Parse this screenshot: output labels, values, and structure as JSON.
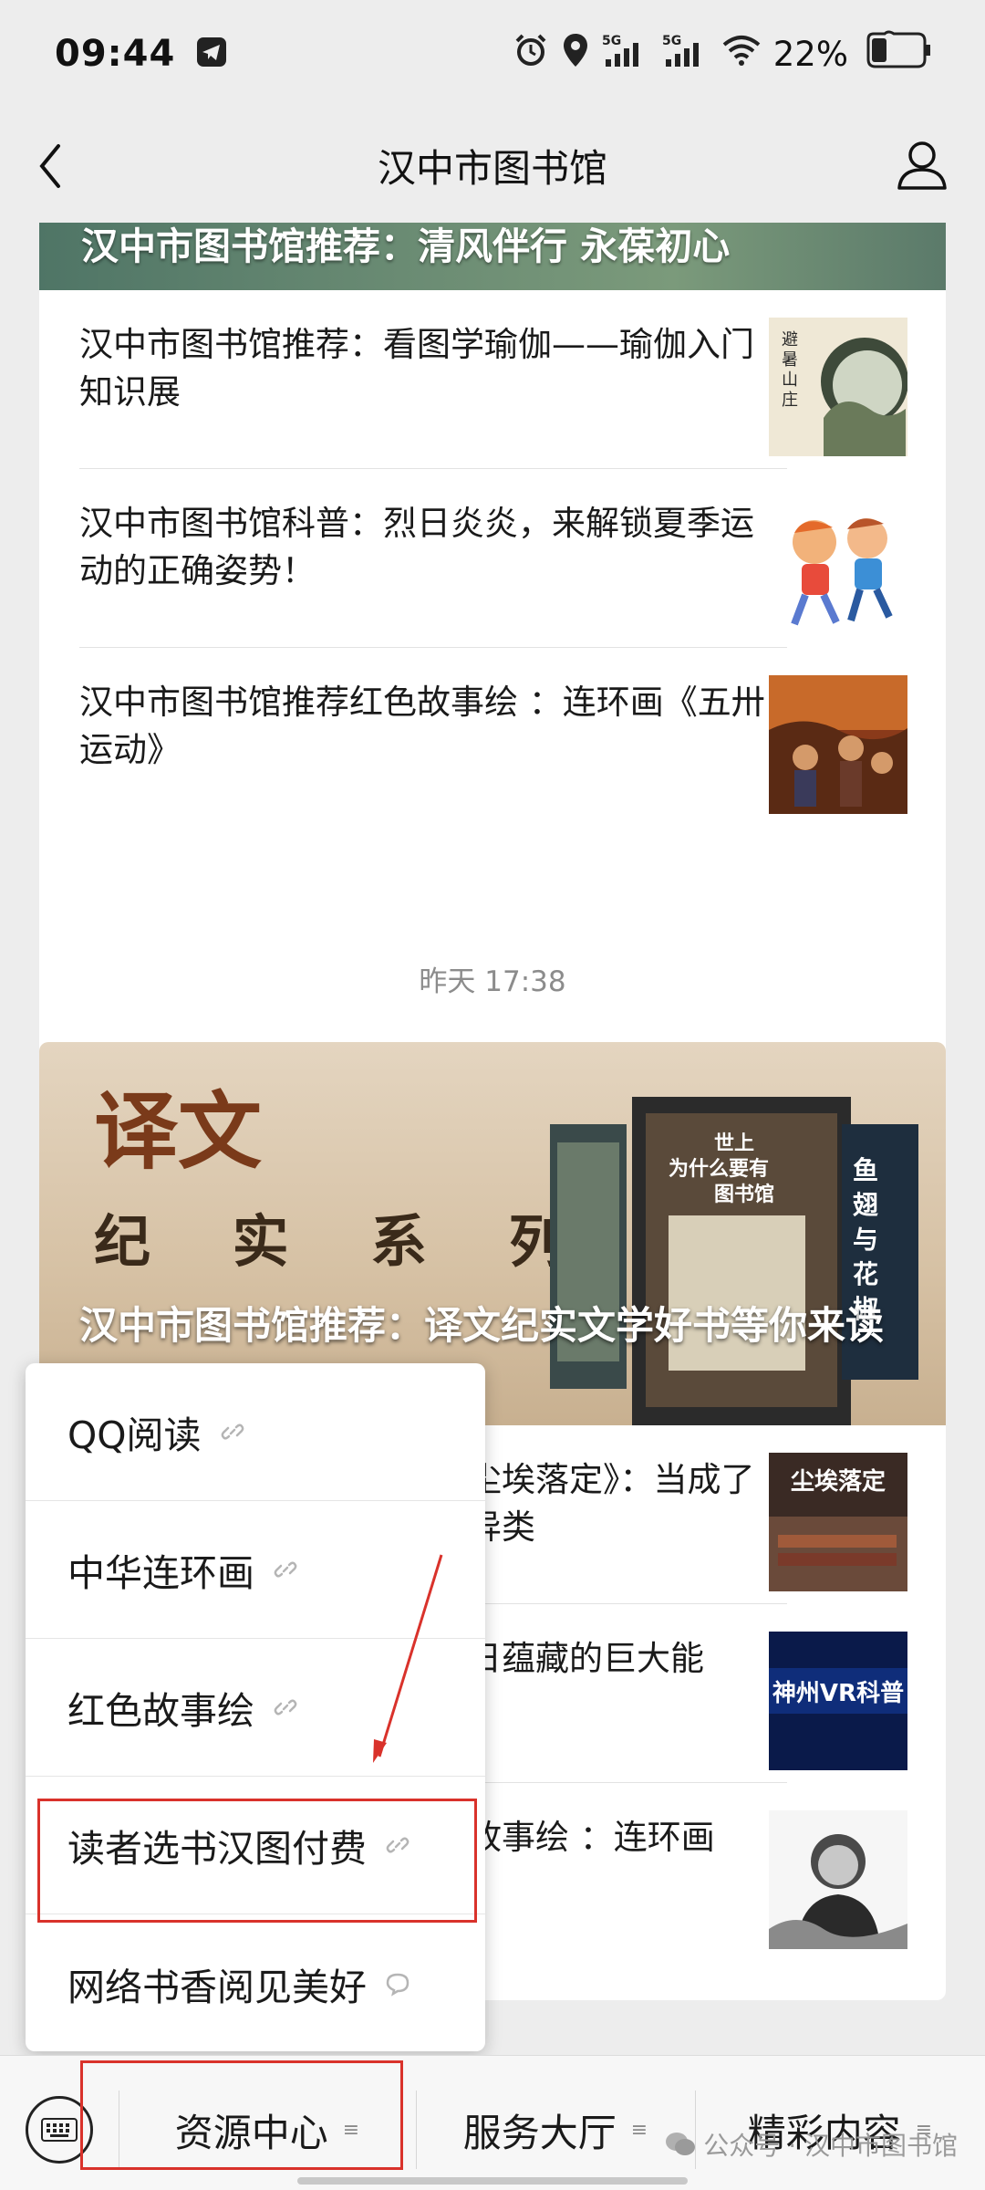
{
  "status_bar": {
    "time": "09:44",
    "battery": "22%",
    "icons": [
      "telegram-icon",
      "alarm-icon",
      "location-icon",
      "5g-signal-icon",
      "5g-signal-icon",
      "wifi-icon",
      "battery-icon"
    ]
  },
  "header": {
    "title": "汉中市图书馆"
  },
  "feed": {
    "card1": {
      "cover_title": "汉中市图书馆推荐：清风伴行 永葆初心",
      "articles": [
        {
          "title": "汉中市图书馆推荐：看图学瑜伽——瑜伽入门知识展"
        },
        {
          "title": "汉中市图书馆科普：烈日炎炎，来解锁夏季运动的正确姿势！"
        },
        {
          "title": "汉中市图书馆推荐红色故事绘 ：连环画《五卅运动》"
        }
      ]
    },
    "time_label": "昨天 17:38",
    "card2": {
      "cover_title": "汉中市图书馆推荐：译文纪实文学好书等你来读",
      "cover_text_1": "译文",
      "cover_text_2": "纪 实 系 列",
      "book_text_1": "世上为什么要有图书馆",
      "book_text_2": "鱼翅与花椒",
      "articles": [
        {
          "title": "尘埃落定》：当成了异类",
          "thumb_text": "尘埃落定"
        },
        {
          "title": "日蕴藏的巨大能",
          "thumb_text": "神州VR科普"
        },
        {
          "title": "故事绘 ：连环画"
        }
      ]
    }
  },
  "popup_menu": {
    "items": [
      {
        "label": "QQ阅读",
        "icon": "link-icon"
      },
      {
        "label": "中华连环画",
        "icon": "link-icon"
      },
      {
        "label": "红色故事绘",
        "icon": "link-icon"
      },
      {
        "label": "读者选书汉图付费",
        "icon": "link-icon"
      },
      {
        "label": "网络书香阅见美好",
        "icon": "mini-program-icon"
      }
    ]
  },
  "bottom_bar": {
    "tabs": [
      {
        "label": "资源中心"
      },
      {
        "label": "服务大厅"
      },
      {
        "label": "精彩内容"
      }
    ],
    "watermark": "公众号 · 汉中市图书馆"
  },
  "colors": {
    "highlight": "#d9322b",
    "background": "#ededed"
  }
}
